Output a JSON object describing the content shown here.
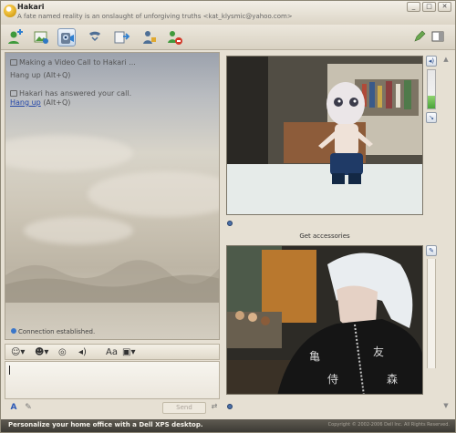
{
  "window": {
    "contact_name": "Hakari",
    "contact_status": "A fate named reality is an onslaught of unforgiving truths <kat_klysmic@yahoo.com>",
    "controls": [
      "minimize",
      "maximize",
      "close"
    ]
  },
  "toolbar": {
    "buttons": [
      {
        "name": "add-contact",
        "icon": "person-plus-icon"
      },
      {
        "name": "photos",
        "icon": "photo-share-icon"
      },
      {
        "name": "video-call",
        "icon": "webcam-icon",
        "active": true
      },
      {
        "name": "call-phone",
        "icon": "phone-handset-icon"
      },
      {
        "name": "send-file",
        "icon": "file-transfer-icon"
      },
      {
        "name": "games",
        "icon": "game-icon"
      },
      {
        "name": "block",
        "icon": "block-contact-icon"
      }
    ],
    "right_icons": [
      "pencil-icon",
      "sidebar-toggle-icon"
    ]
  },
  "chat": {
    "messages": [
      {
        "type": "info",
        "text": "Making a Video Call to Hakari ..."
      },
      {
        "type": "action",
        "link": "Hang up",
        "shortcut": "(Alt+Q)"
      },
      {
        "type": "info",
        "text": "Hakari has answered your call."
      },
      {
        "type": "action",
        "link": "Hang up",
        "shortcut": "(Alt+Q)"
      }
    ],
    "connection_status": "Connection established."
  },
  "format_bar": {
    "items": [
      "emoticon-icon",
      "wink-icon",
      "nudge-icon",
      "voice-clip-icon",
      "font-size-icon",
      "background-icon"
    ]
  },
  "input": {
    "value": "",
    "send_label": "Send"
  },
  "video": {
    "accessories_label": "Get accessories"
  },
  "ad": {
    "text": "Personalize your home office with a Dell XPS desktop.",
    "copyright": "Copyright © 2002-2006 Dell Inc. All Rights Reserved."
  },
  "colors": {
    "link": "#2346a8",
    "active_button": "#c7d7ea",
    "volume_level": "#4aa33a"
  }
}
